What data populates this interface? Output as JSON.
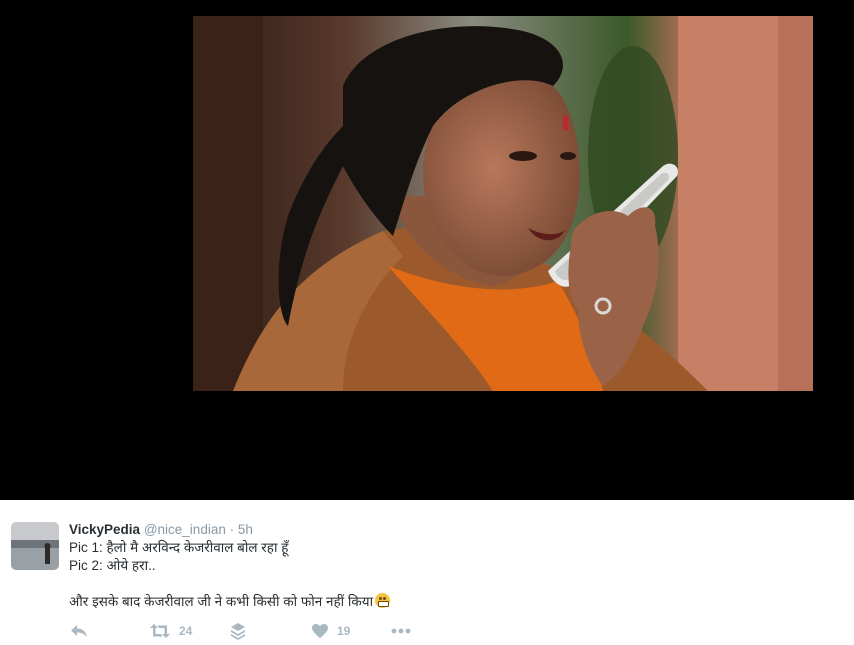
{
  "tweet": {
    "fullname": "VickyPedia",
    "handle": "@nice_indian",
    "separator": "·",
    "time": "5h",
    "line1": "Pic 1: हैलो मै अरविन्द केजरीवाल बोल रहा हूँ",
    "line2": "Pic 2: ओये हरा..",
    "line3": "और इसके बाद केजरीवाल जी ने कभी किसी को फोन नहीं किया"
  },
  "actions": {
    "retweet_count": "24",
    "like_count": "19"
  },
  "icons": {
    "reply": "reply-icon",
    "retweet": "retweet-icon",
    "stack": "stack-icon",
    "like": "heart-icon",
    "more": "more-dots-icon",
    "emoji": "grimacing-face-emoji"
  },
  "colors": {
    "action_gray": "#aab8c2",
    "secondary_text": "#8899a6",
    "primary_text": "#292f33",
    "media_background": "#000000"
  }
}
